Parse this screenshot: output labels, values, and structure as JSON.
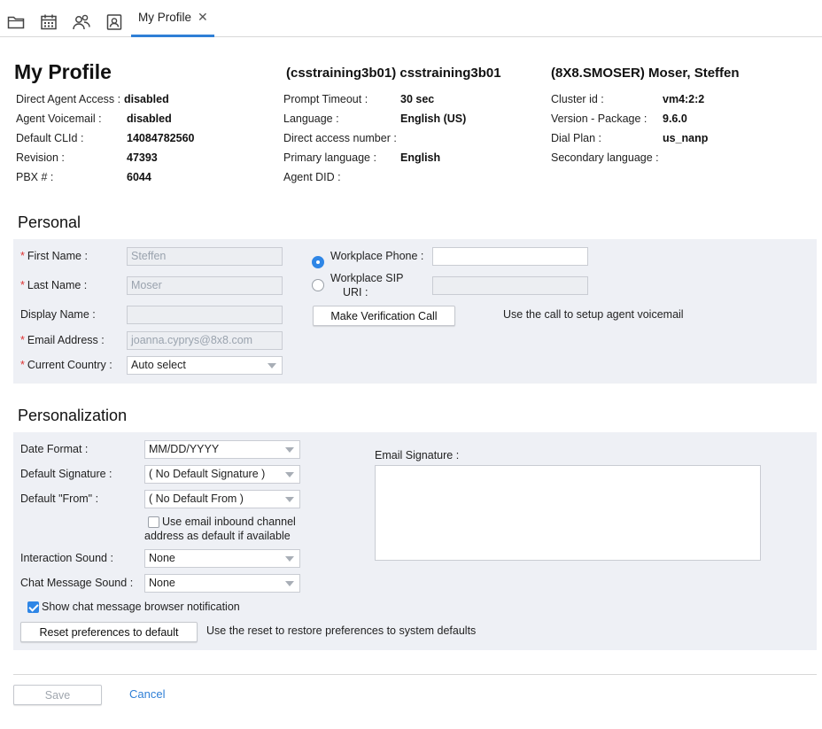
{
  "toolbar": {
    "icons": [
      "folder-icon",
      "calendar-icon",
      "users-icon",
      "contact-card-icon"
    ],
    "tab_label": "My Profile",
    "tab_close": "✕"
  },
  "header": {
    "title": "My Profile",
    "tenant": "(csstraining3b01) csstraining3b01",
    "agent": "(8X8.SMOSER) Moser, Steffen"
  },
  "info": {
    "col1": [
      {
        "label": "Direct Agent Access :",
        "value": "disabled"
      },
      {
        "label": "Agent Voicemail :",
        "value": "disabled"
      },
      {
        "label": "Default CLId :",
        "value": "14084782560"
      },
      {
        "label": "Revision :",
        "value": "47393"
      },
      {
        "label": "PBX # :",
        "value": "6044"
      }
    ],
    "col2": [
      {
        "label": "Prompt Timeout :",
        "value": "30 sec"
      },
      {
        "label": "Language :",
        "value": "English (US)"
      },
      {
        "label": "Direct access number :",
        "value": ""
      },
      {
        "label": "Primary language :",
        "value": "English"
      },
      {
        "label": "Agent DID :",
        "value": ""
      }
    ],
    "col3": [
      {
        "label": "Cluster id :",
        "value": "vm4:2:2"
      },
      {
        "label": "Version - Package :",
        "value": "9.6.0"
      },
      {
        "label": "Dial Plan :",
        "value": "us_nanp"
      },
      {
        "label": "Secondary language :",
        "value": ""
      }
    ]
  },
  "personal": {
    "title": "Personal",
    "first_name_label": "First Name :",
    "first_name_value": "Steffen",
    "last_name_label": "Last Name :",
    "last_name_value": "Moser",
    "display_name_label": "Display Name :",
    "display_name_value": "",
    "email_label": "Email Address :",
    "email_value": "joanna.cyprys@8x8.com",
    "country_label": "Current Country :",
    "country_value": "Auto select",
    "workplace_phone_label": "Workplace Phone :",
    "workplace_phone_value": "",
    "workplace_sip_label_1": "Workplace SIP",
    "workplace_sip_label_2": "URI :",
    "workplace_sip_value": "",
    "verify_button": "Make Verification Call",
    "verify_hint": "Use the call to setup agent voicemail",
    "required_mark": "*"
  },
  "personalization": {
    "title": "Personalization",
    "date_format_label": "Date Format :",
    "date_format_value": "MM/DD/YYYY",
    "default_signature_label": "Default Signature :",
    "default_signature_value": "( No Default Signature )",
    "default_from_label": "Default \"From\" :",
    "default_from_value": "( No Default From )",
    "use_inbound_label_1": "Use email inbound channel",
    "use_inbound_label_2": "address as default if available",
    "interaction_sound_label": "Interaction Sound :",
    "interaction_sound_value": "None",
    "chat_sound_label": "Chat Message Sound :",
    "chat_sound_value": "None",
    "show_notification_label": "Show chat message browser notification",
    "reset_button": "Reset preferences to default",
    "reset_hint": "Use the reset to restore preferences to system defaults",
    "email_signature_label": "Email Signature :"
  },
  "footer": {
    "save_label": "Save",
    "cancel_label": "Cancel"
  },
  "colors": {
    "accent": "#2f7fd6",
    "panel_bg": "#eef0f5",
    "required": "#d33333"
  }
}
